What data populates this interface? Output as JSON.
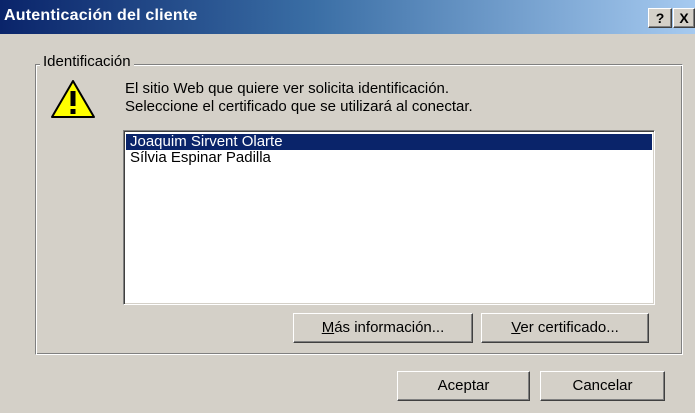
{
  "window": {
    "title": "Autenticación del cliente",
    "help_label": "?",
    "close_label": "X"
  },
  "group": {
    "label": "Identificación"
  },
  "message": {
    "line1": "El sitio Web que quiere ver solicita identificación.",
    "line2": "Seleccione el certificado que se utilizará al conectar."
  },
  "certificates": {
    "items": [
      {
        "label": "Joaquim Sirvent Olarte",
        "selected": true
      },
      {
        "label": "Sílvia Espinar Padilla",
        "selected": false
      }
    ]
  },
  "buttons": {
    "more_info": {
      "accel": "M",
      "rest": "ás información..."
    },
    "view_cert": {
      "accel": "V",
      "rest": "er certificado..."
    },
    "ok": "Aceptar",
    "cancel": "Cancelar"
  },
  "icons": {
    "warning": "warning-icon"
  },
  "colors": {
    "titlebar_start": "#0a246a",
    "titlebar_end": "#a6caf0",
    "face": "#d4d0c8",
    "selection": "#0a246a"
  }
}
